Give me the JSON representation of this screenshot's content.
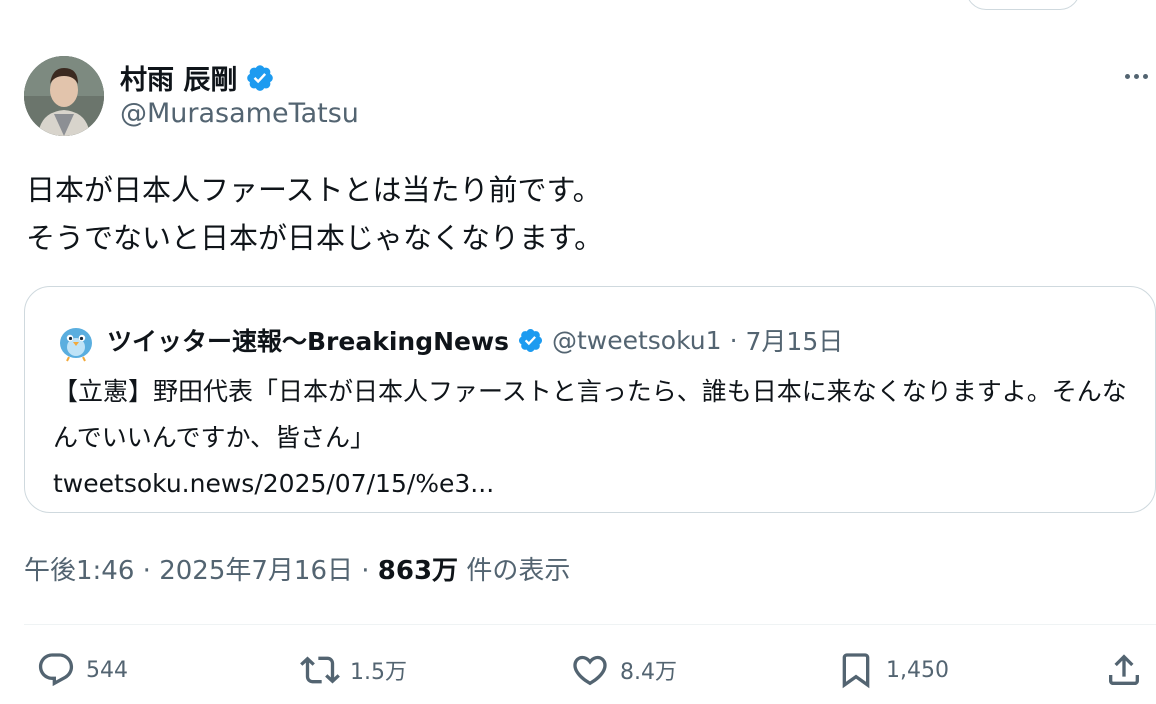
{
  "author": {
    "name": "村雨 辰剛",
    "handle": "@MurasameTatsu"
  },
  "tweet": {
    "lines": [
      "日本が日本人ファーストとは当たり前です。",
      "そうでないと日本が日本じゃなくなります。"
    ]
  },
  "quote": {
    "name": "ツイッター速報〜BreakingNews",
    "handle": "@tweetsoku1",
    "separator": "·",
    "date": "7月15日",
    "text": "【立憲】野田代表「日本が日本人ファーストと言ったら、誰も日本に来なくなりますよ。そんなんでいいんですか、皆さん」",
    "link": "tweetsoku.news/2025/07/15/%e3..."
  },
  "meta": {
    "time": "午後1:46",
    "sep1": " · ",
    "date": "2025年7月16日",
    "sep2": " · ",
    "views": "863万",
    "views_label": " 件の表示"
  },
  "actions": {
    "replies": "544",
    "reposts": "1.5万",
    "likes": "8.4万",
    "bookmarks": "1,450"
  },
  "colors": {
    "verified": "#1d9bf0",
    "text": "#0f1419",
    "secondary": "#536471"
  },
  "icons": [
    "verified-icon",
    "more-icon",
    "reply-icon",
    "repost-icon",
    "like-icon",
    "bookmark-icon",
    "share-icon"
  ]
}
